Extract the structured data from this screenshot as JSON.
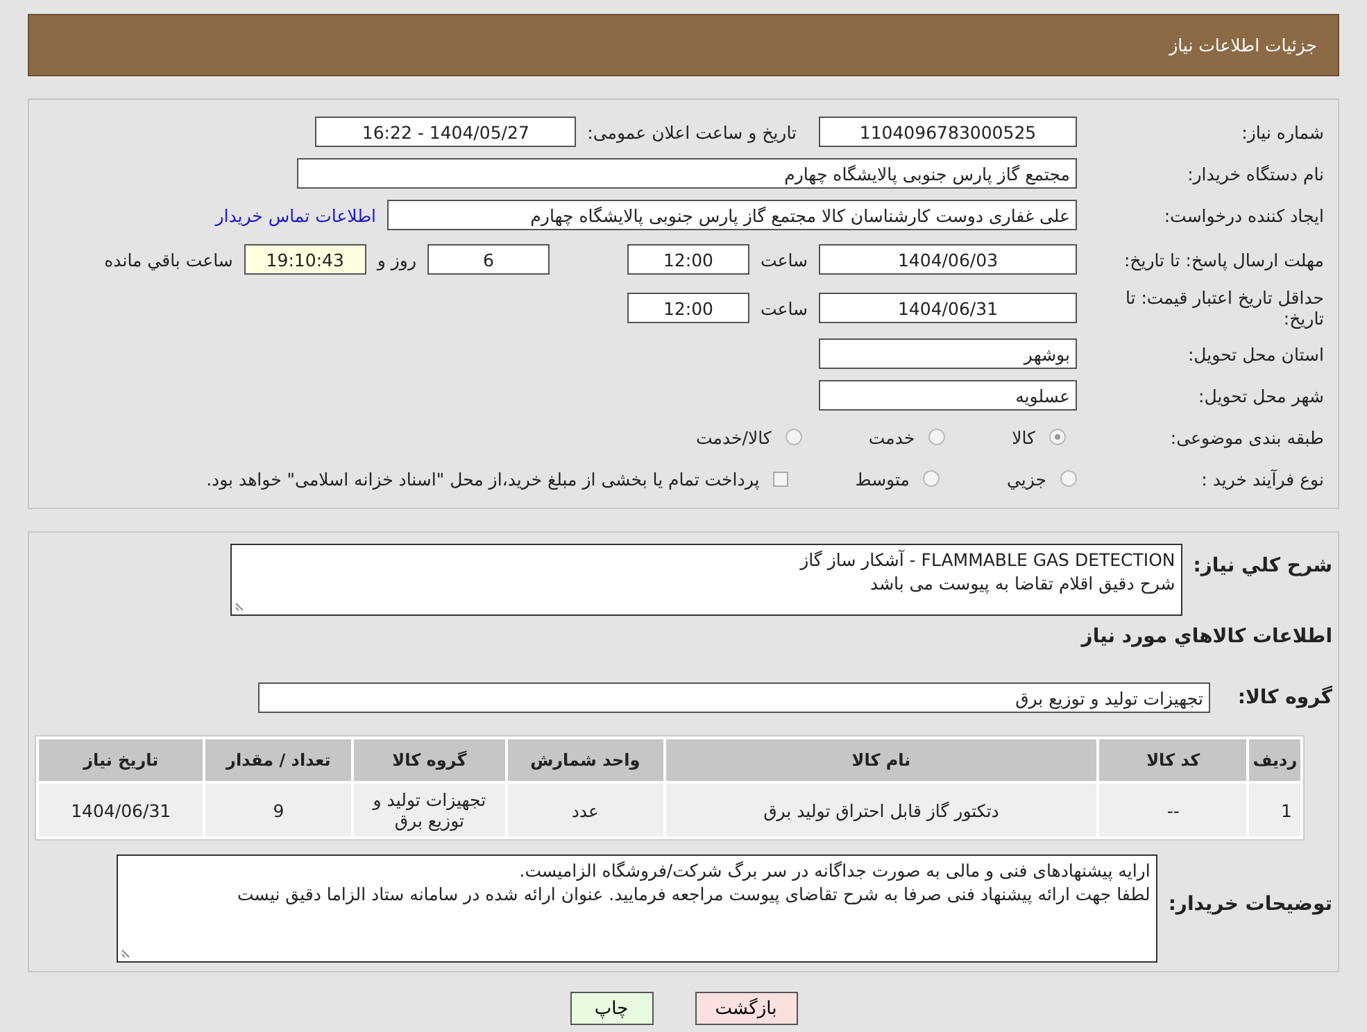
{
  "header": {
    "title": "جزئیات اطلاعات نیاز"
  },
  "details": {
    "need_number": {
      "label": "شماره نیاز:",
      "value": "1104096783000525"
    },
    "announce": {
      "label": "تاریخ و ساعت اعلان عمومی:",
      "value": "1404/05/27 - 16:22"
    },
    "buyer": {
      "label": "نام دستگاه خریدار:",
      "value": "مجتمع گاز پارس جنوبی  پالایشگاه چهارم"
    },
    "requester": {
      "label": "ایجاد کننده درخواست:",
      "value": "علی غفاری دوست کارشناسان کالا مجتمع گاز پارس جنوبی  پالایشگاه چهارم",
      "link": "اطلاعات تماس خریدار"
    },
    "deadline": {
      "label": "مهلت ارسال پاسخ: تا تاریخ:",
      "date": "1404/06/03",
      "time_label": "ساعت",
      "time": "12:00",
      "days": "6",
      "days_label": "روز و",
      "remaining": "19:10:43",
      "remaining_label": "ساعت باقي مانده"
    },
    "validity": {
      "label": "حداقل تاریخ اعتبار قیمت: تا تاریخ:",
      "date": "1404/06/31",
      "time_label": "ساعت",
      "time": "12:00"
    },
    "province": {
      "label": "استان محل تحویل:",
      "value": "بوشهر"
    },
    "city": {
      "label": "شهر محل تحویل:",
      "value": "عسلویه"
    },
    "category": {
      "label": "طبقه بندی موضوعی:",
      "options": [
        {
          "kind": "radio",
          "label": "کالا",
          "selected": true
        },
        {
          "kind": "radio",
          "label": "خدمت",
          "selected": false
        },
        {
          "kind": "radio",
          "label": "کالا/خدمت",
          "selected": false
        }
      ]
    },
    "purchase_type": {
      "label": "نوع فرآیند خرید :",
      "options": [
        {
          "kind": "radio",
          "label": "جزيي",
          "selected": false
        },
        {
          "kind": "radio",
          "label": "متوسط",
          "selected": false
        },
        {
          "kind": "checkbox",
          "label": "پرداخت تمام یا بخشی از مبلغ خرید،از محل \"اسناد خزانه اسلامی\" خواهد بود.",
          "selected": false
        }
      ]
    }
  },
  "description": {
    "label": "شرح كلي نياز:",
    "lines": [
      "FLAMMABLE GAS DETECTION - آشکار ساز گاز",
      "شرح دقیق اقلام تقاضا به پیوست می باشد"
    ]
  },
  "goods_title": "اطلاعات كالاهاي مورد نياز",
  "goods_group": {
    "label": "گروه کالا:",
    "value": "تجهیزات تولید و توزیع برق"
  },
  "table": {
    "columns": [
      "ردیف",
      "کد کالا",
      "نام کالا",
      "واحد شمارش",
      "گروه کالا",
      "تعداد / مقدار",
      "تاریخ نیاز"
    ],
    "rows": [
      {
        "cells": [
          "1",
          "--",
          "دتکتور گاز قابل احتراق تولید برق",
          "عدد",
          "تجهیزات تولید و توزیع برق",
          "9",
          "1404/06/31"
        ]
      }
    ]
  },
  "buyer_notes": {
    "label": "توضیحات خریدار:",
    "lines": [
      "ارایه پیشنهادهای فنی و مالی به صورت جداگانه در سر برگ شرکت/فروشگاه الزامیست.",
      "لطفا جهت ارائه پیشنهاد فنی صرفا به شرح تقاضای پیوست مراجعه فرمایید. عنوان ارائه شده در سامانه ستاد الزاما دقیق نیست"
    ]
  },
  "buttons": [
    {
      "kind": "back",
      "label": "بازگشت"
    },
    {
      "kind": "print",
      "label": "چاپ"
    }
  ]
}
